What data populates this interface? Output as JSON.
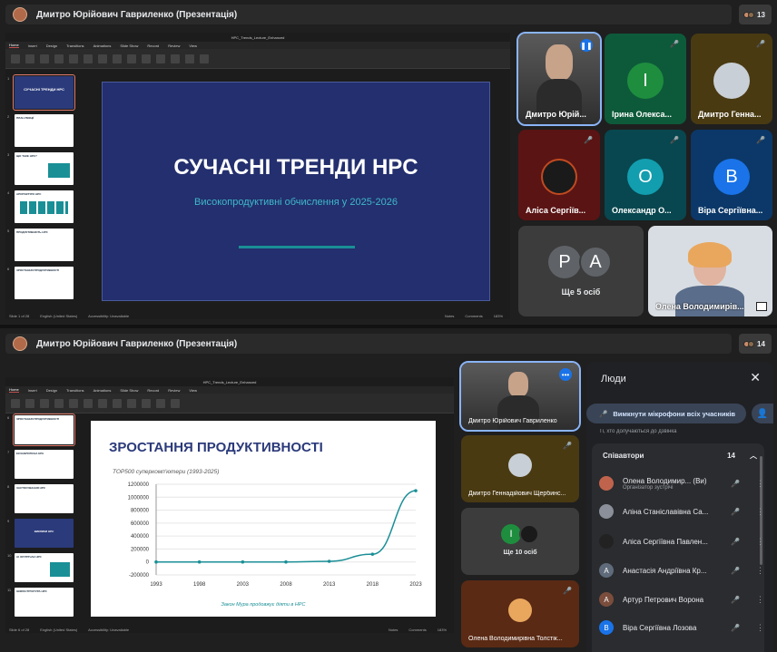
{
  "top": {
    "title": "Дмитро Юрійович Гавриленко (Презентація)",
    "count": "13",
    "ppt": {
      "file": "HPC_Trends_Lecture_Enhanced",
      "search": "Search (Cmd + Ctrl + U)",
      "share": "Share",
      "menu": [
        "Home",
        "Insert",
        "Design",
        "Transitions",
        "Animations",
        "Slide Show",
        "Record",
        "Review",
        "View"
      ],
      "status": [
        "Slide 1 of 28",
        "English (United States)",
        "Accessibility: Unavailable"
      ],
      "status_right": [
        "Notes",
        "Comments",
        "183%"
      ],
      "slide": {
        "title": "СУЧАСНІ ТРЕНДИ HPC",
        "subtitle": "Високопродуктивні обчислення у 2025-2026"
      },
      "thumbs": [
        {
          "n": "1",
          "t": "СУЧАСНІ ТРЕНДИ HPC"
        },
        {
          "n": "2",
          "t": "ПЛАН ЛЕКЦІЇ"
        },
        {
          "n": "3",
          "t": "ЩО ТАКЕ HPC?"
        },
        {
          "n": "4",
          "t": "АРХІТЕКТУРА HPC"
        },
        {
          "n": "5",
          "t": "ПРОДУКТИВНІСТЬ HPC"
        },
        {
          "n": "6",
          "t": "ЗРОСТАННЯ ПРОДУКТИВНОСТІ"
        }
      ]
    },
    "tiles": [
      {
        "name": "Дмитро Юрій...",
        "letter": ""
      },
      {
        "name": "Ірина Олекса...",
        "letter": "І"
      },
      {
        "name": "Дмитро Генна...",
        "letter": ""
      },
      {
        "name": "Аліса Сергіїв...",
        "letter": ""
      },
      {
        "name": "Олександр О...",
        "letter": "О"
      },
      {
        "name": "Віра Сергіївна...",
        "letter": "В"
      },
      {
        "name": "Ще 5 осіб",
        "letter": ""
      },
      {
        "name": "Олена Володимирів...",
        "letter": ""
      }
    ],
    "more_letters": [
      "Р",
      "А"
    ]
  },
  "bottom": {
    "title": "Дмитро Юрійович Гавриленко (Презентація)",
    "count": "14",
    "ppt": {
      "file": "HPC_Trends_Lecture_Enhanced",
      "search": "Search (Cmd + Ctrl + U)",
      "share": "Share",
      "menu": [
        "Home",
        "Insert",
        "Design",
        "Transitions",
        "Animations",
        "Slide Show",
        "Record",
        "Review",
        "View"
      ],
      "status": [
        "Slide 6 of 28",
        "English (United States)",
        "Accessibility: Unavailable"
      ],
      "status_right": [
        "Notes",
        "Comments",
        "183%"
      ],
      "thumbs": [
        {
          "n": "6",
          "t": "ЗРОСТАННЯ ПРОДУКТИВНОСТІ"
        },
        {
          "n": "7",
          "t": "ЕКЗАФЛОПСНА ЕРА"
        },
        {
          "n": "8",
          "t": "ЗАСТОСУВАННЯ HPC"
        },
        {
          "n": "9",
          "t": "ВИКЛИКИ HPC"
        },
        {
          "n": "10",
          "t": "AI ЗУСТРІЧАЄ HPC"
        },
        {
          "n": "11",
          "t": "ІНФРАСТРУКТУРА HPC"
        }
      ]
    },
    "tiles": [
      {
        "name": "Дмитро Юрійович Гавриленко"
      },
      {
        "name": "Дмитро Геннадійович Щербинс..."
      },
      {
        "name": "Ще 10 осіб"
      },
      {
        "name": "Олена Володимирівна Толстік..."
      }
    ],
    "more_letters": [
      "І"
    ]
  },
  "chart_data": {
    "type": "line",
    "title": "ЗРОСТАННЯ ПРОДУКТИВНОСТІ",
    "subtitle": "TOP500 суперкомп'ютери (1993-2025)",
    "footer": "Закон Мура продовжує діяти в HPC",
    "x": [
      1993,
      1998,
      2003,
      2008,
      2013,
      2018,
      2023
    ],
    "y": [
      0,
      0,
      0,
      0,
      10000,
      120000,
      1100000
    ],
    "yticks": [
      -200000,
      0,
      200000,
      400000,
      600000,
      800000,
      1000000,
      1200000
    ],
    "ylim": [
      -200000,
      1200000
    ],
    "color": "#1a8f96"
  },
  "people": {
    "title": "Люди",
    "mute_all": "Вимкнути мікрофони всіх учасників",
    "hint": "Ті, хто долучаються до дзвінка",
    "section": "Співавтори",
    "section_count": "14",
    "list": [
      {
        "name": "Олена Володимир... (Ви)",
        "sub": "Організатор зустрічі",
        "letter": "",
        "color": "#c0634d"
      },
      {
        "name": "Аліна Станіславівна Са...",
        "sub": "",
        "letter": "",
        "color": "#8a8f99"
      },
      {
        "name": "Аліса Сергіївна Павлен...",
        "sub": "",
        "letter": "",
        "color": "#222"
      },
      {
        "name": "Анастасія Андріївна Кр...",
        "sub": "",
        "letter": "А",
        "color": "#5f6b7a"
      },
      {
        "name": "Артур Петрович Ворона",
        "sub": "",
        "letter": "А",
        "color": "#7a4d3d"
      },
      {
        "name": "Віра Сергіївна Лозова",
        "sub": "",
        "letter": "В",
        "color": "#1a73e8"
      }
    ]
  }
}
